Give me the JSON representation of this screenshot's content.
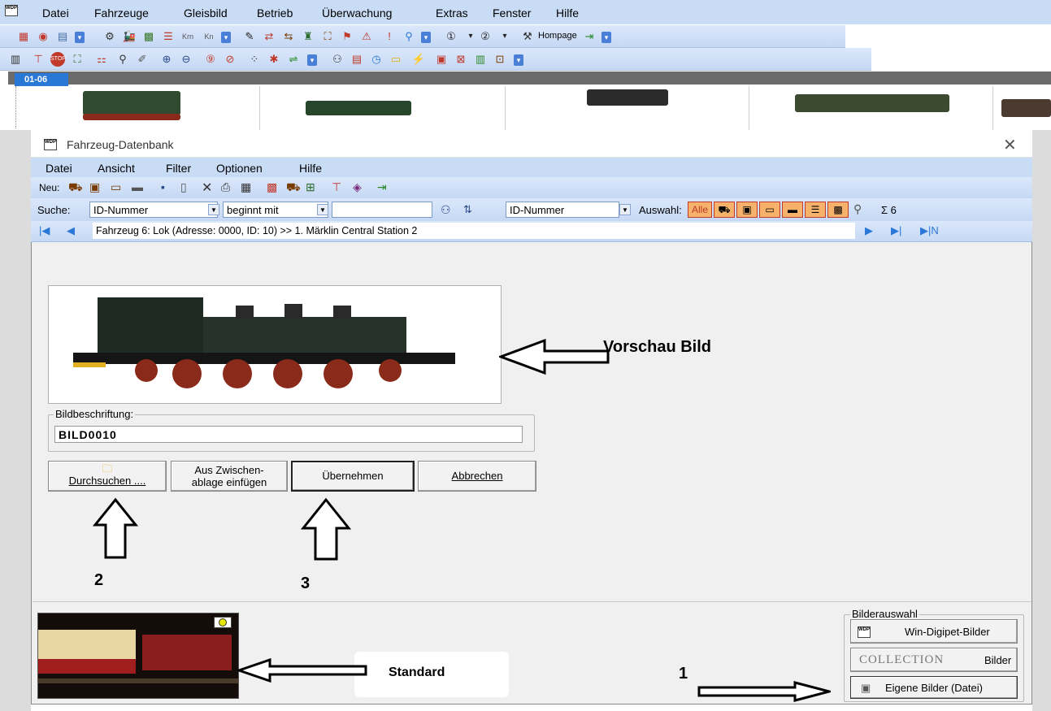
{
  "app_menu": {
    "items": [
      "Datei",
      "Fahrzeuge",
      "Gleisbild",
      "Betrieb",
      "Überwachung",
      "Extras",
      "Fenster",
      "Hilfe"
    ],
    "logo": "WDP"
  },
  "toolbar": {
    "hompage_label": "Hompage"
  },
  "loco_strip": {
    "tab_label": "01-06"
  },
  "dialog": {
    "title": "Fahrzeug-Datenbank",
    "menu": [
      "Datei",
      "Ansicht",
      "Filter",
      "Optionen",
      "Hilfe"
    ],
    "new_label": "Neu:",
    "search": {
      "label": "Suche:",
      "field_value": "ID-Nummer",
      "mode_value": "beginnt mit",
      "input_value": "",
      "sort_value": "ID-Nummer",
      "auswahl_label": "Auswahl:",
      "alle_label": "Alle",
      "sum_label": "Σ 6"
    },
    "nav": {
      "record_text": "Fahrzeug 6: Lok (Adresse: 0000, ID: 10) >> 1. Märklin Central Station 2",
      "last_new_label": "▶|N"
    },
    "caption_group": {
      "label": "Bildbeschriftung:",
      "value": "BILD0010"
    },
    "buttons": {
      "browse": "Durchsuchen ....",
      "paste_line1": "Aus Zwischen-",
      "paste_line2": "ablage einfügen",
      "apply": "Übernehmen",
      "cancel": "Abbrechen"
    },
    "picture_source": {
      "label": "Bilderauswahl",
      "wdp_button": "Win-Digipet-Bilder",
      "collection_word": "COLLECTION",
      "collection_button": "Bilder",
      "own_button": "Eigene Bilder (Datei)",
      "wdp_logo": "WDP"
    }
  },
  "annotations": {
    "preview": "Vorschau Bild",
    "standard": "Standard",
    "num1": "1",
    "num2": "2",
    "num3": "3"
  },
  "colors": {
    "menubar": "#c9dcf6",
    "toolbar": "#d4e3f8",
    "tab_accent": "#2a78d6",
    "dialog_bg": "#f0f0f0"
  }
}
